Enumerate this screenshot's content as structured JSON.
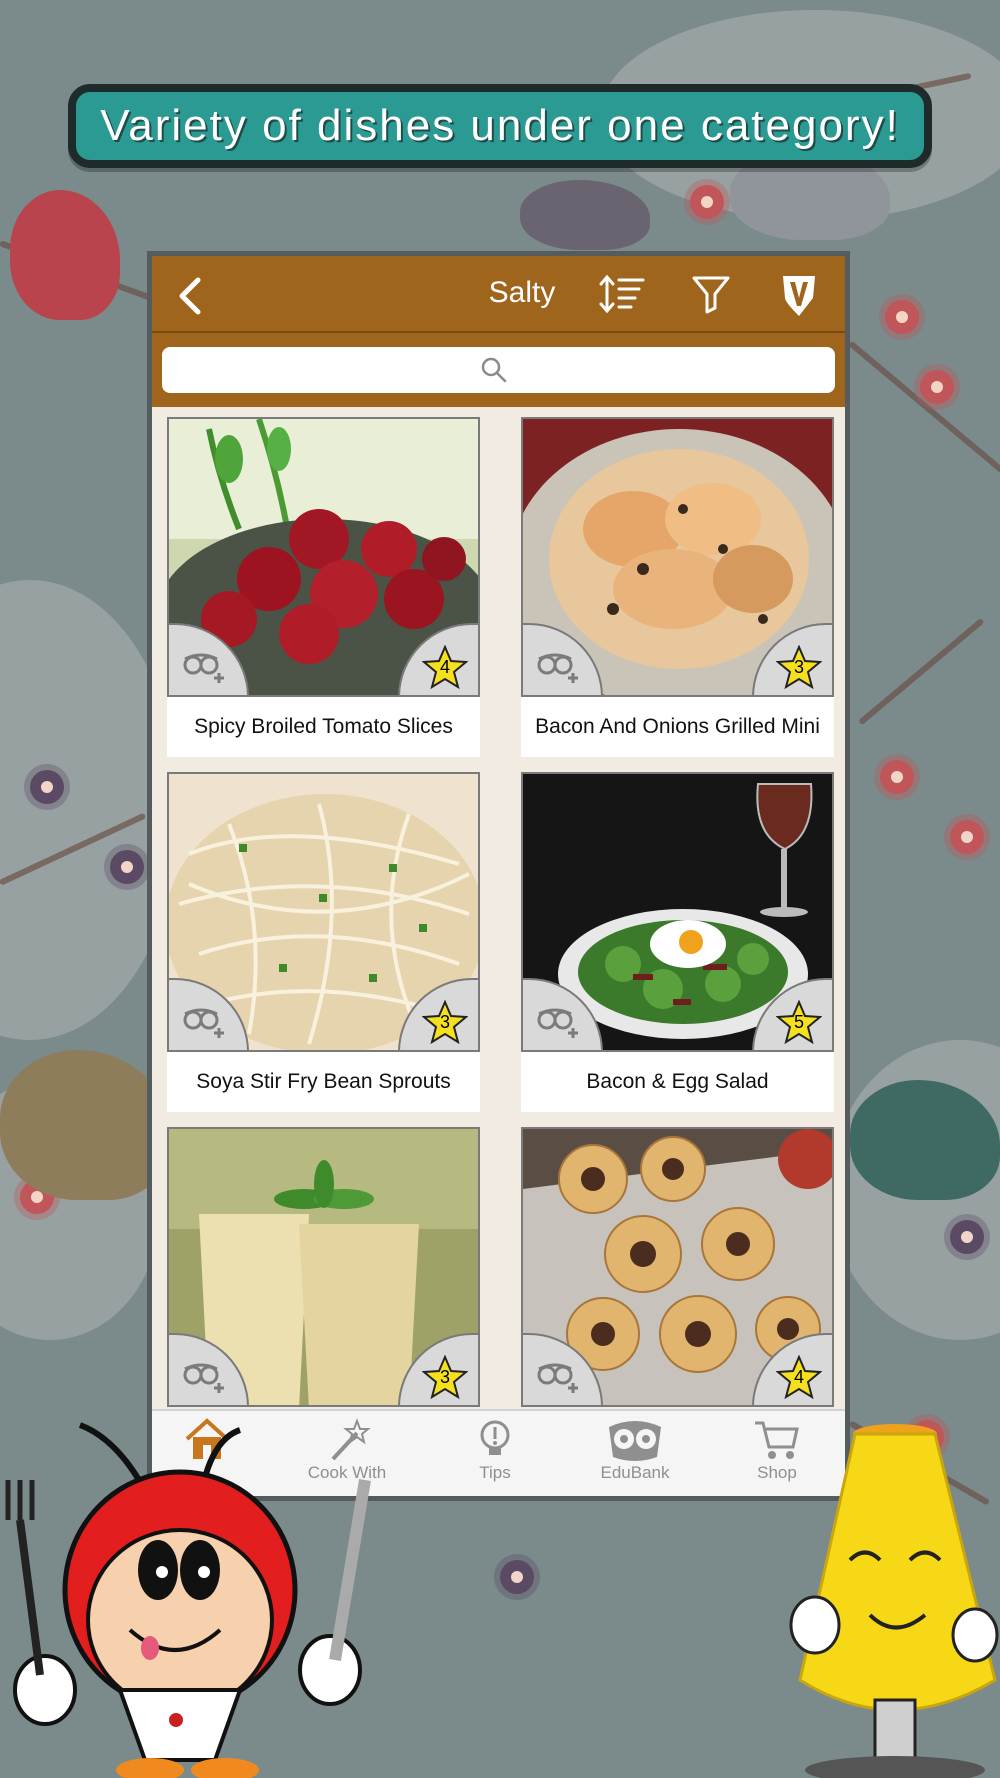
{
  "banner": {
    "text": "Variety of dishes under one category!"
  },
  "header": {
    "title": "Salty"
  },
  "search": {
    "placeholder": "",
    "value": ""
  },
  "recipes": [
    {
      "title": "Spicy Broiled Tomato Slices",
      "rating": "4"
    },
    {
      "title": "Bacon And Onions Grilled Mini",
      "rating": "3"
    },
    {
      "title": "Soya Stir Fry Bean Sprouts",
      "rating": "3"
    },
    {
      "title": "Bacon & Egg Salad",
      "rating": "5"
    },
    {
      "title": "",
      "rating": "3"
    },
    {
      "title": "",
      "rating": "4"
    }
  ],
  "nav": {
    "items": [
      {
        "label": "Home",
        "icon": "home-icon"
      },
      {
        "label": "Cook With",
        "icon": "magic-wand-icon"
      },
      {
        "label": "Tips",
        "icon": "lightbulb-icon"
      },
      {
        "label": "EduBank",
        "icon": "owl-icon"
      },
      {
        "label": "Shop",
        "icon": "cart-icon"
      }
    ],
    "active_color": "#c8761e"
  },
  "colors": {
    "header": "#a0651c",
    "banner": "#2b9a93",
    "star": "#f5e020"
  }
}
